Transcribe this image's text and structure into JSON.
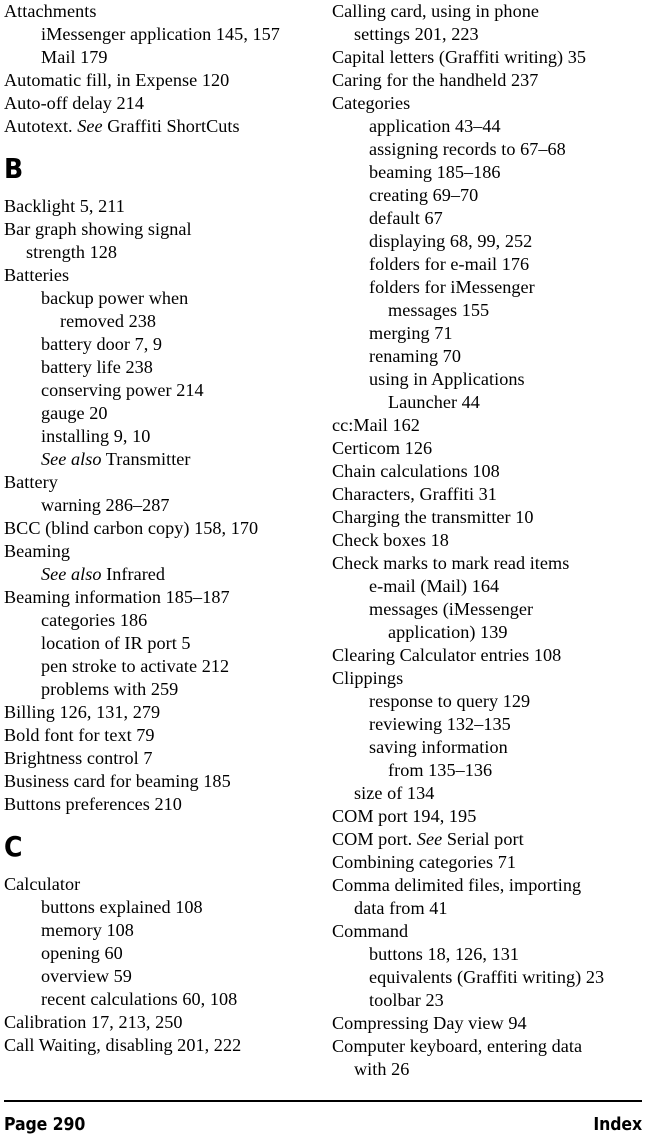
{
  "page": {
    "page_label": "Page 290",
    "section_label": "Index",
    "rule_color": "#000000"
  },
  "columns": [
    {
      "id": "left-column",
      "blocks": [
        {
          "type": "entries",
          "items": [
            {
              "level": "main",
              "text": "Attachments"
            },
            {
              "level": "sub",
              "text": "iMessenger application 145, 157"
            },
            {
              "level": "sub",
              "text": "Mail 179"
            },
            {
              "level": "main",
              "text": "Automatic fill, in Expense 120"
            },
            {
              "level": "main",
              "text": "Auto-off delay 214"
            },
            {
              "level": "main",
              "text": "Autotext. ",
              "italic": "See",
              "after": " Graffiti ShortCuts"
            }
          ]
        },
        {
          "type": "heading",
          "letter": "B"
        },
        {
          "type": "entries",
          "items": [
            {
              "level": "main",
              "text": "Backlight 5, 211"
            },
            {
              "level": "main",
              "text": "Bar graph showing signal"
            },
            {
              "level": "cont",
              "text": "strength 128"
            },
            {
              "level": "main",
              "text": "Batteries"
            },
            {
              "level": "sub",
              "text": "backup power when"
            },
            {
              "level": "sub2",
              "text": "removed 238"
            },
            {
              "level": "sub",
              "text": "battery door 7, 9"
            },
            {
              "level": "sub",
              "text": "battery life 238"
            },
            {
              "level": "sub",
              "text": "conserving power 214"
            },
            {
              "level": "sub",
              "text": "gauge 20"
            },
            {
              "level": "sub",
              "text": "installing 9, 10"
            },
            {
              "level": "sub",
              "text": "",
              "italic": "See also",
              "after": " Transmitter"
            },
            {
              "level": "main",
              "text": "Battery"
            },
            {
              "level": "sub",
              "text": "warning 286–287"
            },
            {
              "level": "main",
              "text": "BCC (blind carbon copy) 158, 170"
            },
            {
              "level": "main",
              "text": "Beaming"
            },
            {
              "level": "sub",
              "text": "",
              "italic": "See also",
              "after": " Infrared"
            },
            {
              "level": "main",
              "text": "Beaming information 185–187"
            },
            {
              "level": "sub",
              "text": "categories 186"
            },
            {
              "level": "sub",
              "text": "location of IR port 5"
            },
            {
              "level": "sub",
              "text": "pen stroke to activate 212"
            },
            {
              "level": "sub",
              "text": "problems with 259"
            },
            {
              "level": "main",
              "text": "Billing 126, 131, 279"
            },
            {
              "level": "main",
              "text": "Bold font for text 79"
            },
            {
              "level": "main",
              "text": "Brightness control 7"
            },
            {
              "level": "main",
              "text": "Business card for beaming 185"
            },
            {
              "level": "main",
              "text": "Buttons preferences 210"
            }
          ]
        },
        {
          "type": "heading",
          "letter": "C"
        },
        {
          "type": "entries",
          "items": [
            {
              "level": "main",
              "text": "Calculator"
            },
            {
              "level": "sub",
              "text": "buttons explained 108"
            },
            {
              "level": "sub",
              "text": "memory 108"
            },
            {
              "level": "sub",
              "text": "opening 60"
            },
            {
              "level": "sub",
              "text": "overview 59"
            },
            {
              "level": "sub",
              "text": "recent calculations 60, 108"
            },
            {
              "level": "main",
              "text": "Calibration 17, 213, 250"
            },
            {
              "level": "main",
              "text": "Call Waiting, disabling 201, 222"
            }
          ]
        }
      ]
    },
    {
      "id": "right-column",
      "blocks": [
        {
          "type": "entries",
          "items": [
            {
              "level": "main",
              "text": "Calling card, using in phone"
            },
            {
              "level": "cont",
              "text": "settings 201, 223"
            },
            {
              "level": "main",
              "text": "Capital letters (Graffiti writing) 35"
            },
            {
              "level": "main",
              "text": "Caring for the handheld 237"
            },
            {
              "level": "main",
              "text": "Categories"
            },
            {
              "level": "sub",
              "text": "application 43–44"
            },
            {
              "level": "sub",
              "text": "assigning records to 67–68"
            },
            {
              "level": "sub",
              "text": "beaming 185–186"
            },
            {
              "level": "sub",
              "text": "creating 69–70"
            },
            {
              "level": "sub",
              "text": "default 67"
            },
            {
              "level": "sub",
              "text": "displaying 68, 99, 252"
            },
            {
              "level": "sub",
              "text": "folders for e-mail 176"
            },
            {
              "level": "sub",
              "text": "folders for iMessenger"
            },
            {
              "level": "sub2",
              "text": "messages 155"
            },
            {
              "level": "sub",
              "text": "merging 71"
            },
            {
              "level": "sub",
              "text": "renaming 70"
            },
            {
              "level": "sub",
              "text": "using in Applications"
            },
            {
              "level": "sub2",
              "text": "Launcher 44"
            },
            {
              "level": "main",
              "text": "cc:Mail 162"
            },
            {
              "level": "main",
              "text": "Certicom 126"
            },
            {
              "level": "main",
              "text": "Chain calculations 108"
            },
            {
              "level": "main",
              "text": "Characters, Graffiti 31"
            },
            {
              "level": "main",
              "text": "Charging the transmitter 10"
            },
            {
              "level": "main",
              "text": "Check boxes 18"
            },
            {
              "level": "main",
              "text": "Check marks to mark read items"
            },
            {
              "level": "sub",
              "text": "e-mail (Mail) 164"
            },
            {
              "level": "sub",
              "text": "messages (iMessenger"
            },
            {
              "level": "sub2",
              "text": "application) 139"
            },
            {
              "level": "main",
              "text": "Clearing Calculator entries 108"
            },
            {
              "level": "main",
              "text": "Clippings"
            },
            {
              "level": "sub",
              "text": "response to query 129"
            },
            {
              "level": "sub",
              "text": "reviewing 132–135"
            },
            {
              "level": "sub",
              "text": "saving information"
            },
            {
              "level": "sub2",
              "text": "from 135–136"
            },
            {
              "level": "cont",
              "text": "size of 134"
            },
            {
              "level": "main",
              "text": "COM port 194, 195"
            },
            {
              "level": "main",
              "text": "COM port. ",
              "italic": "See",
              "after": " Serial port"
            },
            {
              "level": "main",
              "text": "Combining categories 71"
            },
            {
              "level": "main",
              "text": "Comma delimited files, importing"
            },
            {
              "level": "cont",
              "text": "data from 41"
            },
            {
              "level": "main",
              "text": "Command"
            },
            {
              "level": "sub",
              "text": "buttons 18, 126, 131"
            },
            {
              "level": "sub",
              "text": "equivalents (Graffiti writing) 23"
            },
            {
              "level": "sub",
              "text": "toolbar 23"
            },
            {
              "level": "main",
              "text": "Compressing Day view 94"
            },
            {
              "level": "main",
              "text": "Computer keyboard, entering data"
            },
            {
              "level": "cont",
              "text": "with 26"
            }
          ]
        }
      ]
    }
  ]
}
